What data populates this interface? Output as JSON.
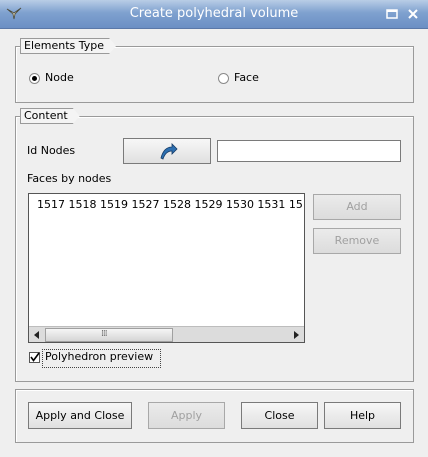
{
  "window": {
    "title": "Create polyhedral volume"
  },
  "elements_type": {
    "title": "Elements Type",
    "options": [
      {
        "label": "Node",
        "checked": true
      },
      {
        "label": "Face",
        "checked": false
      }
    ]
  },
  "content": {
    "title": "Content",
    "id_nodes_label": "Id Nodes",
    "id_nodes_value": "",
    "faces_label": "Faces by nodes",
    "faces_text": "1517 1518 1519 1527 1528 1529 1530 1531 15",
    "add_label": "Add",
    "remove_label": "Remove",
    "preview_label": "Polyhedron preview",
    "preview_checked": true
  },
  "buttons": {
    "apply_close": "Apply and Close",
    "apply": "Apply",
    "close": "Close",
    "help": "Help"
  }
}
